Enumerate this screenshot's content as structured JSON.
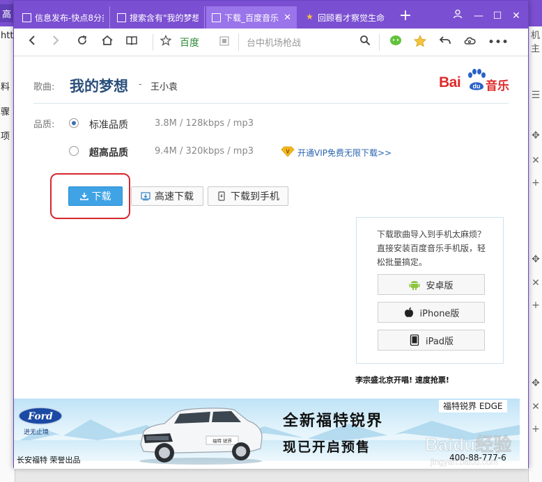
{
  "background": {
    "tab_fragment": "高",
    "left_fragments": [
      "htt",
      "料",
      "骤",
      "项"
    ],
    "right_fragment": "机主"
  },
  "tabs": [
    {
      "label": "信息发布-快点8分类",
      "icon": "page-icon"
    },
    {
      "label": "搜索含有\"我的梦想",
      "icon": "page-icon"
    },
    {
      "label": "下载_百度音乐",
      "icon": "page-icon",
      "active": true
    },
    {
      "label": "回顾看才察觉生命",
      "icon": "star-icon"
    }
  ],
  "toolbar": {
    "bookmark_label": "百度",
    "search_text": "台中机场枪战"
  },
  "song": {
    "label": "歌曲:",
    "title": "我的梦想",
    "dash": "-",
    "artist": "王小袁"
  },
  "logo": {
    "bai": "Bai",
    "du": "du",
    "music": "音乐"
  },
  "quality": {
    "label": "品质:",
    "options": [
      {
        "name": "标准品质",
        "spec": "3.8M / 128kbps / mp3",
        "checked": true
      },
      {
        "name": "超高品质",
        "spec": "9.4M / 320kbps / mp3",
        "checked": false
      }
    ],
    "vip_link": "开通VIP免费无限下载>>"
  },
  "buttons": {
    "download": "下载",
    "fast_download": "高速下载",
    "to_phone": "下载到手机"
  },
  "promo": {
    "text": "下载歌曲导入到手机太麻烦？直接安装百度音乐手机版，轻松批量搞定。",
    "apps": [
      "安卓版",
      "iPhone版",
      "iPad版"
    ],
    "caption": "李宗盛北京开唱! 速度抢票!"
  },
  "banner": {
    "slogan": "进无止境",
    "dealer": "长安福特  荣誉出品",
    "model": "福特锐界 EDGE",
    "headline": "全新福特锐界",
    "sub": "现已开启预售",
    "phone": "400-88-777-6",
    "brand": "Ford",
    "plate": "福特 锐界"
  },
  "watermark": {
    "text": "Baidu经验",
    "url": "jingyan.baidu.com"
  },
  "colors": {
    "titlebar": "#7b4fd1",
    "active_tab": "#9a74ea",
    "download_button": "#3fa3e6",
    "highlight": "#d8262d",
    "link": "#2a64b0",
    "title": "#2a4f7a"
  }
}
